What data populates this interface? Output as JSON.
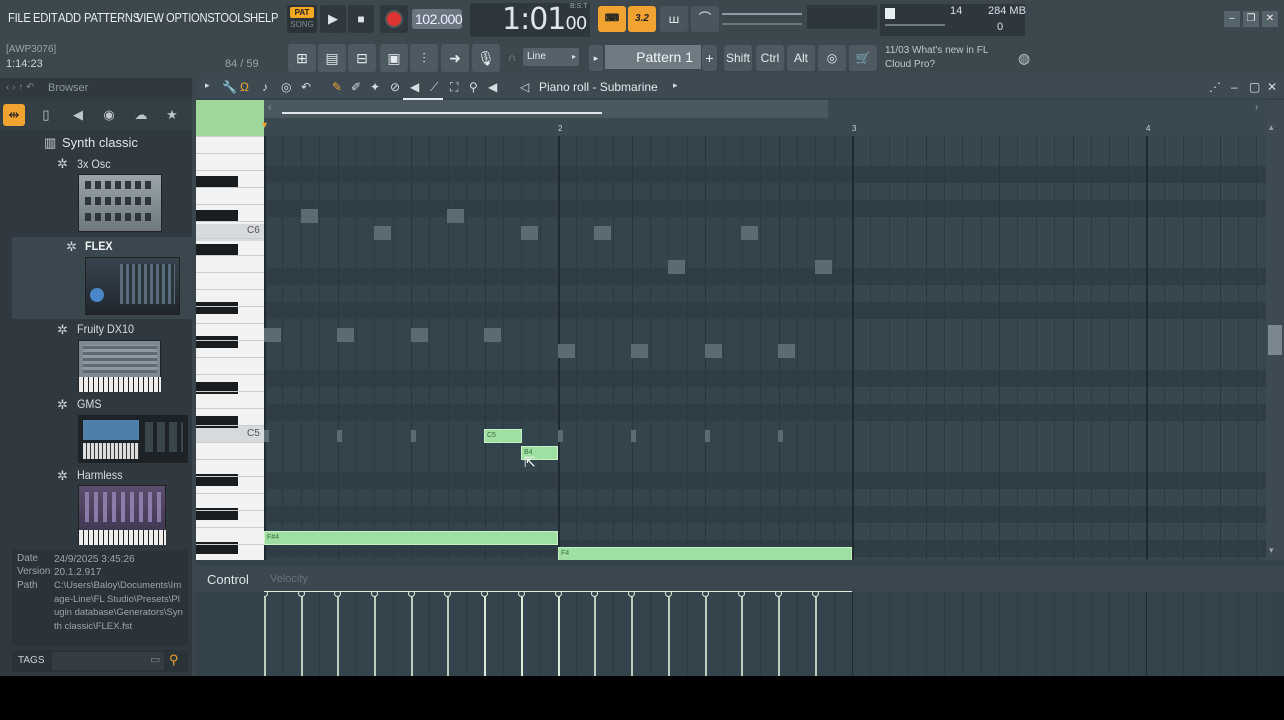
{
  "menu": [
    "FILE",
    "EDIT",
    "ADD",
    "PATTERNS",
    "VIEW",
    "OPTIONS",
    "TOOLS",
    "HELP"
  ],
  "transport": {
    "pat_label": "PAT",
    "song_label": "SONG",
    "play_icon": "▶",
    "stop_icon": "■",
    "tempo": "102.000",
    "time_main": "1:01",
    "time_small": "00",
    "time_sub": "B:S:T"
  },
  "status": {
    "cpu": "14",
    "memory": "284 MB",
    "polyphony": "0"
  },
  "toolbar2": {
    "project_label": "[AWP3076]",
    "project_time": "1:14:23",
    "project_count": "84 / 59",
    "snap": "Line",
    "pattern": "Pattern 1",
    "keys": [
      "Shift",
      "Ctrl",
      "Alt"
    ],
    "news": [
      "11/03  What's new in FL",
      "Cloud Pro?"
    ]
  },
  "browser": {
    "title": "Browser",
    "folder": "Synth classic",
    "plugins": [
      "3x Osc",
      "FLEX",
      "Fruity DX10",
      "GMS",
      "Harmless"
    ],
    "info": {
      "date_key": "Date",
      "date_val": "24/9/2025 3:45:26",
      "version_key": "Version",
      "version_val": "20.1.2.917",
      "path_key": "Path",
      "path_val": "C:\\Users\\Baloy\\Documents\\Image-Line\\FL Studio\\Presets\\Plugin database\\Generators\\Synth classic\\FLEX.fst"
    },
    "tags_label": "TAGS"
  },
  "piano_roll": {
    "title": "Piano roll - Submarine",
    "bar_numbers": [
      "2",
      "3",
      "4"
    ],
    "key_labels": [
      "C6",
      "C5"
    ],
    "notes": [
      {
        "label": "C5"
      },
      {
        "label": "B4"
      },
      {
        "label": "F#4"
      },
      {
        "label": "F4"
      }
    ],
    "control_label": "Control",
    "control_target": "Velocity"
  },
  "colors": {
    "accent_orange": "#f0a330",
    "note_green": "#9fe0a2",
    "grid_bg": "#34444c",
    "record_red": "#dd3333"
  }
}
